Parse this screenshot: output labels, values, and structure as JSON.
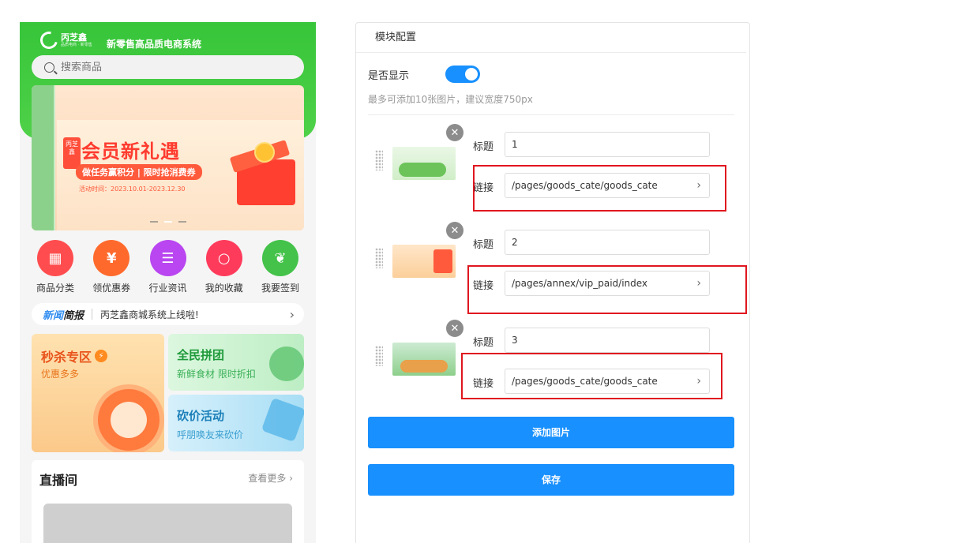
{
  "preview": {
    "logo_text": "丙芝鑫",
    "logo_sub": "品质电商 · 新零售",
    "app_title": "新零售高品质电商系统",
    "search_placeholder": "搜索商品",
    "banner": {
      "badge": "丙芝鑫",
      "title": "会员新礼遇",
      "subtitle": "做任务赢积分 | 限时抢消费券",
      "date": "活动时间：2023.10.01-2023.12.30"
    },
    "categories": [
      {
        "label": "商品分类",
        "icon": "grid-icon",
        "color": "#ff4d4f"
      },
      {
        "label": "领优惠券",
        "icon": "coupon-icon",
        "color": "#ff6a2c"
      },
      {
        "label": "行业资讯",
        "icon": "document-icon",
        "color": "#b946f0"
      },
      {
        "label": "我的收藏",
        "icon": "magnifier-icon",
        "color": "#ff3b5c"
      },
      {
        "label": "我要签到",
        "icon": "leaf-icon",
        "color": "#44c24a"
      }
    ],
    "news": {
      "tag_a": "新闻",
      "tag_b": "简报",
      "text": "丙芝鑫商城系统上线啦!"
    },
    "promo_big": {
      "title": "秒杀专区",
      "subtitle": "优惠多多"
    },
    "promo_group": {
      "title": "全民拼团",
      "subtitle": "新鲜食材 限时折扣"
    },
    "promo_bargain": {
      "title": "砍价活动",
      "subtitle": "呼朋唤友来砍价"
    },
    "live": {
      "title": "直播间",
      "more": "查看更多"
    }
  },
  "panel": {
    "header": "模块配置",
    "show_label": "是否显示",
    "show_enabled": true,
    "hint": "最多可添加10张图片，建议宽度750px",
    "title_label": "标题",
    "link_label": "链接",
    "items": [
      {
        "title": "1",
        "link": "/pages/goods_cate/goods_cate"
      },
      {
        "title": "2",
        "link": "/pages/annex/vip_paid/index"
      },
      {
        "title": "3",
        "link": "/pages/goods_cate/goods_cate"
      }
    ],
    "add_button": "添加图片",
    "save_button": "保存"
  },
  "colors": {
    "accent": "#1890ff",
    "highlight": "#e0161f",
    "brand_green": "#37c53a"
  }
}
